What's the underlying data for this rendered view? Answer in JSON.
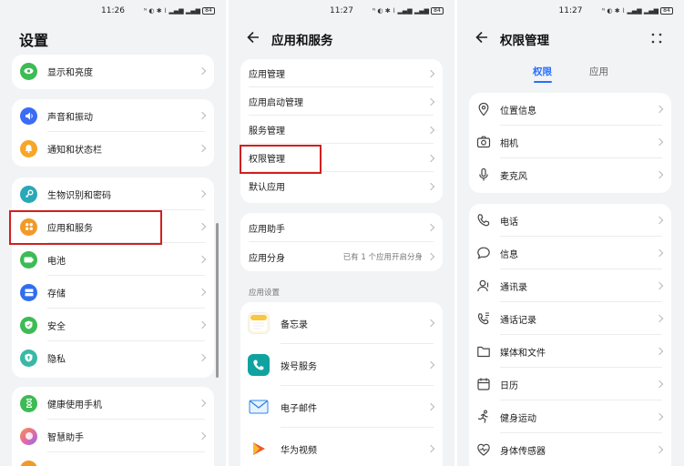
{
  "status": {
    "time": "11:26",
    "time2": "11:27",
    "time3": "11:27",
    "battery": "84"
  },
  "panel1": {
    "title": "设置",
    "items_a": [
      {
        "label": "显示和亮度",
        "color": "#3dbb54",
        "icon": "eye-icon"
      }
    ],
    "items_b": [
      {
        "label": "声音和振动",
        "color": "#3b6cf5",
        "icon": "speaker-icon"
      },
      {
        "label": "通知和状态栏",
        "color": "#f6a628",
        "icon": "bell-icon"
      }
    ],
    "items_c": [
      {
        "label": "生物识别和密码",
        "color": "#27a9b8",
        "icon": "key-icon"
      },
      {
        "label": "应用和服务",
        "color": "#f29a28",
        "icon": "apps-icon"
      },
      {
        "label": "电池",
        "color": "#3dbb54",
        "icon": "battery-icon"
      },
      {
        "label": "存储",
        "color": "#2f6ef0",
        "icon": "storage-icon"
      },
      {
        "label": "安全",
        "color": "#3dbb54",
        "icon": "shield-icon"
      },
      {
        "label": "隐私",
        "color": "#39b9a5",
        "icon": "privacy-icon"
      }
    ],
    "items_d": [
      {
        "label": "健康使用手机",
        "color": "#3dbb54",
        "icon": "hourglass-icon"
      },
      {
        "label": "智慧助手",
        "color": "#e86aa0",
        "icon": "assistant-icon"
      }
    ]
  },
  "panel2": {
    "title": "应用和服务",
    "group1": [
      "应用管理",
      "应用启动管理",
      "服务管理",
      "权限管理",
      "默认应用"
    ],
    "group2": [
      "应用助手",
      "应用分身"
    ],
    "clone_extra": "已有 1 个应用开启分身",
    "section_header": "应用设置",
    "apps": [
      {
        "label": "备忘录",
        "icon": "notes-app-icon",
        "color": "#f7c742"
      },
      {
        "label": "拨号服务",
        "icon": "phone-app-icon",
        "color": "#0fa3a0"
      },
      {
        "label": "电子邮件",
        "icon": "email-app-icon",
        "color": "#2d86e8"
      },
      {
        "label": "华为视频",
        "icon": "video-app-icon",
        "color": "#f2582a"
      }
    ]
  },
  "panel3": {
    "title": "权限管理",
    "tabs": [
      "权限",
      "应用"
    ],
    "group1": [
      {
        "label": "位置信息",
        "icon": "location-icon"
      },
      {
        "label": "相机",
        "icon": "camera-icon"
      },
      {
        "label": "麦克风",
        "icon": "microphone-icon"
      }
    ],
    "group2": [
      {
        "label": "电话",
        "icon": "phone-icon"
      },
      {
        "label": "信息",
        "icon": "message-icon"
      },
      {
        "label": "通讯录",
        "icon": "contacts-icon"
      },
      {
        "label": "通话记录",
        "icon": "call-log-icon"
      },
      {
        "label": "媒体和文件",
        "icon": "folder-icon"
      },
      {
        "label": "日历",
        "icon": "calendar-icon"
      },
      {
        "label": "健身运动",
        "icon": "fitness-icon"
      },
      {
        "label": "身体传感器",
        "icon": "heart-sensor-icon"
      }
    ]
  }
}
